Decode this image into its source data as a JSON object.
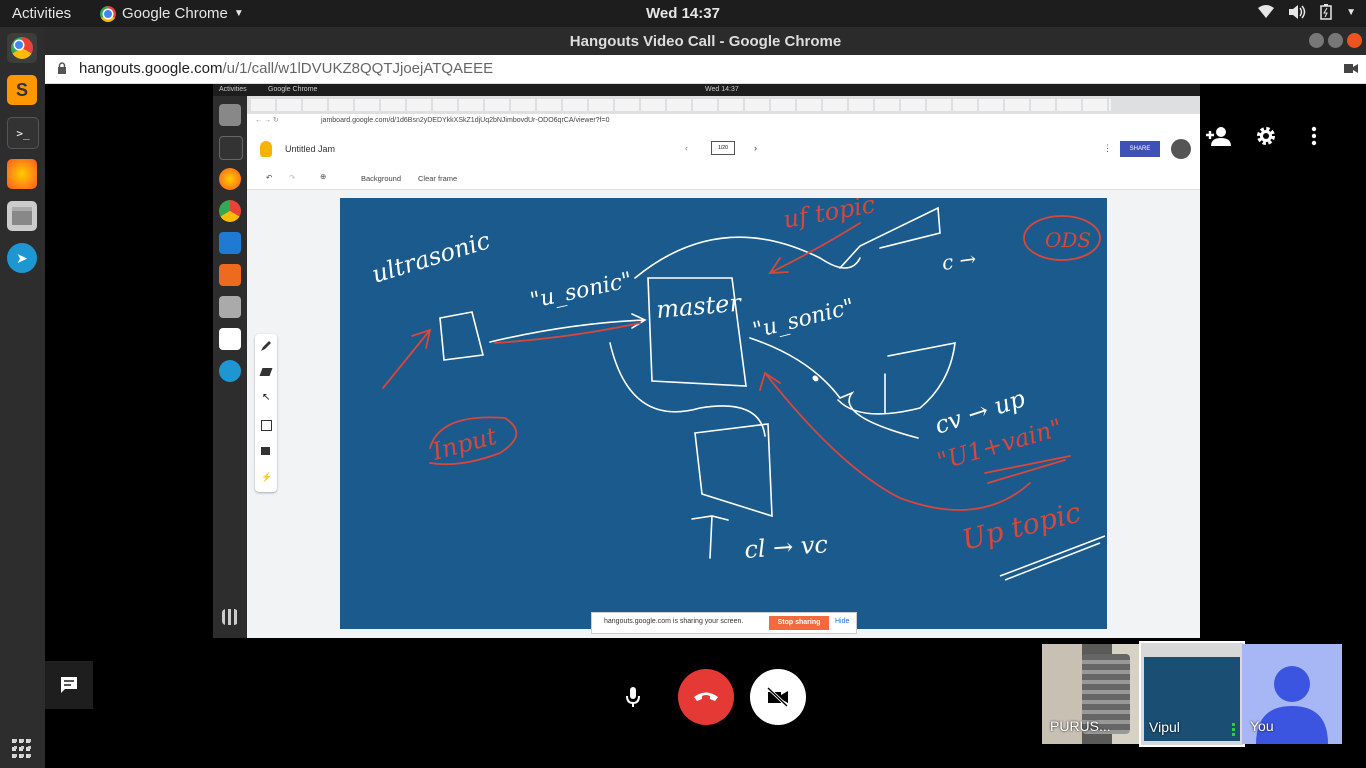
{
  "topbar": {
    "activities": "Activities",
    "app_name": "Google Chrome",
    "clock": "Wed 14:37"
  },
  "window": {
    "title": "Hangouts Video Call - Google Chrome"
  },
  "address": {
    "domain": "hangouts.google.com",
    "path": "/u/1/call/w1lDVUKZ8QQTJjoejATQAEEE"
  },
  "shared_screen": {
    "inner_activities": "Activities",
    "inner_app": "Google Chrome",
    "inner_clock": "Wed 14:37",
    "inner_url": "jamboard.google.com/d/1d6Bsn2yDEDYkkXSkZ1djUq2bNJimbovdUr-ODO6qrCA/viewer?f=0",
    "jam_title": "Untitled Jam",
    "frame_counter": "1/20",
    "share_label": "SHARE",
    "toolbar": {
      "background": "Background",
      "clear_frame": "Clear frame"
    },
    "banner": {
      "text": "hangouts.google.com is sharing your screen.",
      "stop": "Stop sharing",
      "hide": "Hide"
    },
    "handwriting": {
      "ultrasonic": "ultrasonic",
      "u_sonic": "\"u_sonic\"",
      "master": "master",
      "u_sonic_2": "\"u_sonic\"",
      "uf_topic": "uf topic",
      "ods": "ODS",
      "c_arrow": "c →",
      "input": "Input",
      "cv_up": "cv → up",
      "u1_vain": "\"U1+vain\"",
      "cl_vc": "cl → vc",
      "up_topic": "Up topic"
    }
  },
  "participants": [
    {
      "name": "PURUS..."
    },
    {
      "name": "Vipul"
    },
    {
      "name": "You"
    }
  ],
  "colors": {
    "board": "#1a5a8c",
    "hangup": "#e53935",
    "ink_white": "#ffffff",
    "ink_red": "#d9463b",
    "avatar_bg": "#a7b6f5",
    "avatar_fg": "#3c55e0"
  }
}
